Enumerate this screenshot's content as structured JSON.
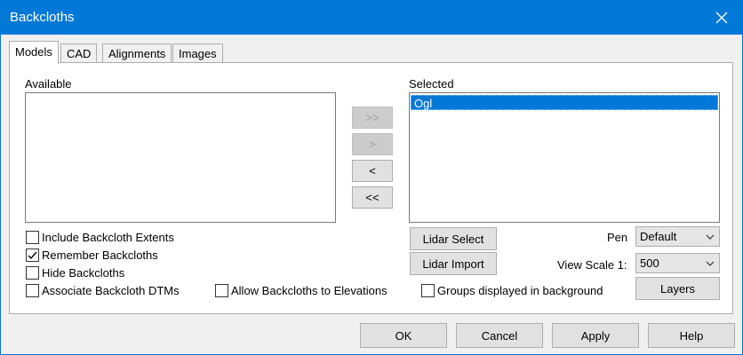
{
  "window": {
    "title": "Backcloths"
  },
  "tabs": [
    {
      "label": "Models"
    },
    {
      "label": "CAD"
    },
    {
      "label": "Alignments"
    },
    {
      "label": "Images"
    }
  ],
  "available": {
    "label": "Available",
    "items": []
  },
  "selected": {
    "label": "Selected",
    "items": [
      "Ogl"
    ]
  },
  "transfer": {
    "add_all": ">>",
    "add": ">",
    "remove": "<",
    "remove_all": "<<"
  },
  "lidar": {
    "select_label": "Lidar Select",
    "import_label": "Lidar Import"
  },
  "pen": {
    "label": "Pen",
    "value": "Default"
  },
  "view_scale": {
    "label": "View Scale 1:",
    "value": "500"
  },
  "layers_label": "Layers",
  "options": {
    "include_extents": {
      "label": "Include Backcloth Extents",
      "checked": false
    },
    "remember": {
      "label": "Remember Backcloths",
      "checked": true
    },
    "hide": {
      "label": "Hide Backcloths",
      "checked": false
    },
    "associate_dtms": {
      "label": "Associate Backcloth DTMs",
      "checked": false
    },
    "allow_elevations": {
      "label": "Allow Backcloths to Elevations",
      "checked": false
    },
    "groups_background": {
      "label": "Groups displayed in background",
      "checked": false
    }
  },
  "footer": {
    "ok": "OK",
    "cancel": "Cancel",
    "apply": "Apply",
    "help": "Help"
  }
}
